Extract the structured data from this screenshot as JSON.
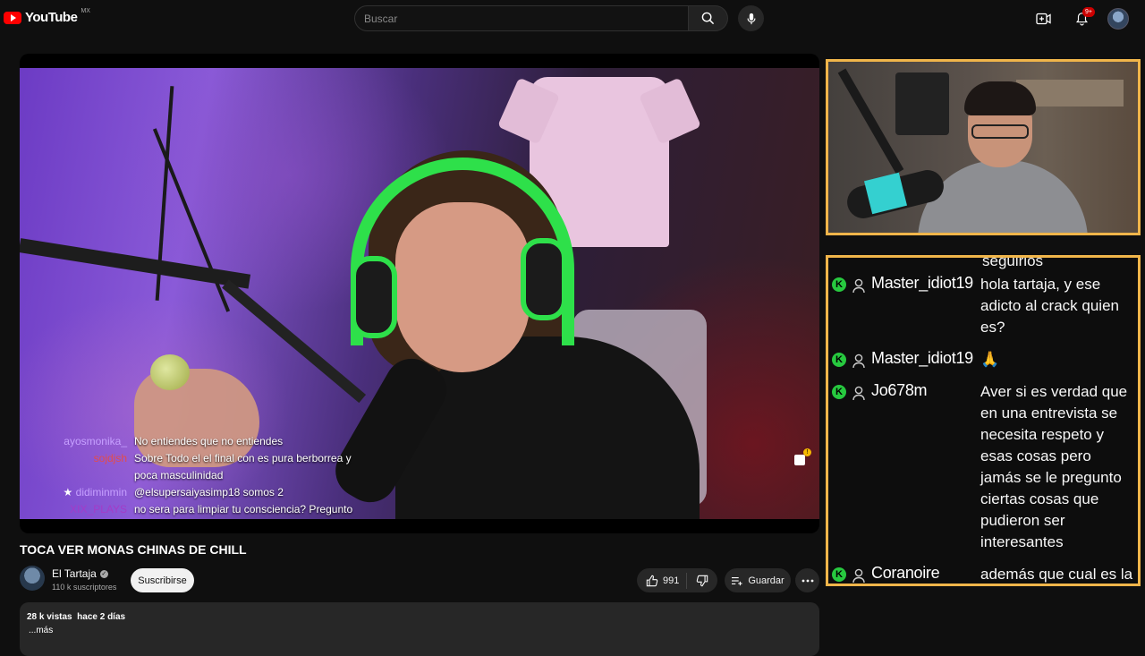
{
  "header": {
    "logo_text": "YouTube",
    "country_code": "MX",
    "search_placeholder": "Buscar",
    "notification_count": "9+"
  },
  "player": {
    "overlay_chat": [
      {
        "name": "ayosmonika_",
        "name_color": "#c6a0ff",
        "message": "No entiendes que no entiendes"
      },
      {
        "name": "sojdjsh",
        "name_color": "#e34c4c",
        "message": "Sobre Todo el el final con es pura berborrea y poca masculinidad"
      },
      {
        "name": "didiminmin",
        "name_color": "#c6a0ff",
        "message": "@elsupersaiyasimp18 somos 2"
      },
      {
        "name": "XIX_PLAYS",
        "name_color": "#a33cc8",
        "message": "no sera para limpiar tu consciencia? Pregunto"
      }
    ]
  },
  "stream_chat": {
    "partial_top": "seguirlos",
    "messages": [
      {
        "badge": "K",
        "user": "Master_idiot19",
        "text": "hola tartaja, y ese adicto al crack quien es?"
      },
      {
        "badge": "K",
        "user": "Master_idiot19",
        "text": "🙏"
      },
      {
        "badge": "K",
        "user": "Jo678m",
        "text": "Aver si es verdad que en una entrevista se necesita respeto y esas cosas pero jamás se le pregunto ciertas cosas que pudieron ser interesantes"
      },
      {
        "badge": "K",
        "user": "Coranoire",
        "text": "además que cual es la necesidad de seguirlos blanqueandolo?"
      }
    ]
  },
  "video": {
    "title": "TOCA VER MONAS CHINAS DE CHILL",
    "channel_name": "El Tartaja",
    "subscribers": "110 k suscriptores",
    "subscribe_label": "Suscribirse",
    "likes": "991",
    "save_label": "Guardar",
    "views_date": "28 k vistas  hace 2 días",
    "more_label": "...más"
  },
  "colors": {
    "accent_frame": "#f0b54a",
    "badge_green": "#27c93f",
    "brand_red": "#ff0000"
  }
}
